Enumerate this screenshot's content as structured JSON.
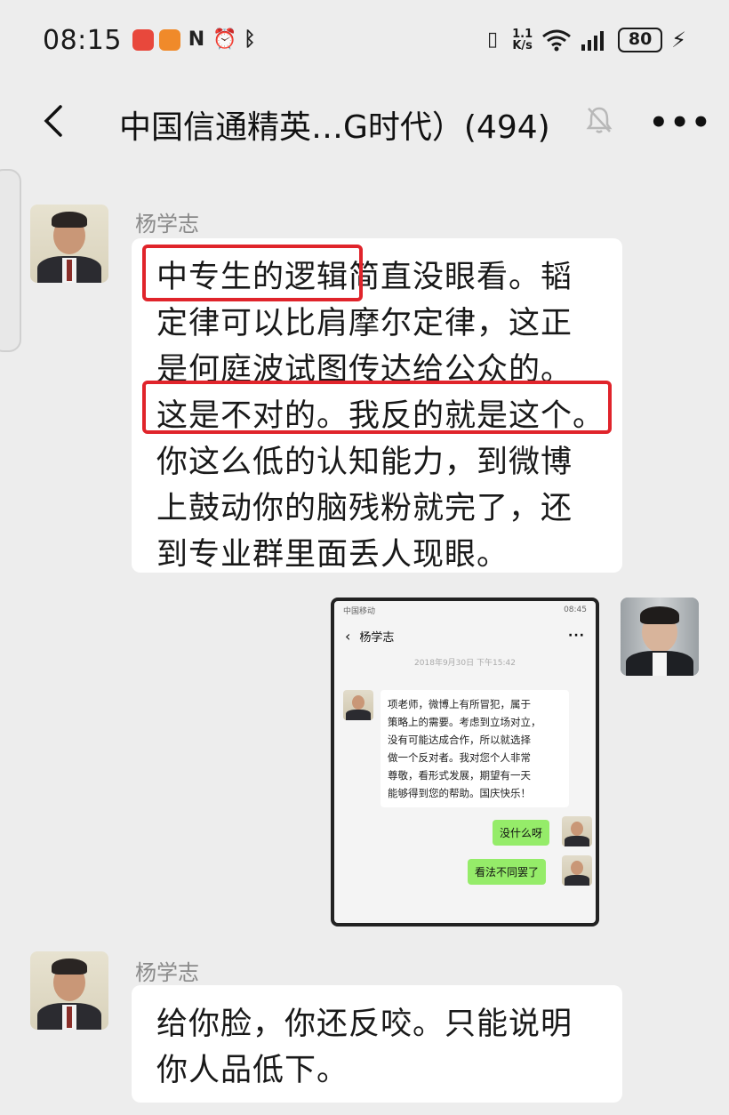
{
  "status_bar": {
    "time": "08:15",
    "net_speed_top": "1.1",
    "net_speed_bottom": "K/s",
    "battery": "80"
  },
  "nav": {
    "title": "中国信通精英…G时代）(494)"
  },
  "messages": [
    {
      "sender": "杨学志",
      "lines": [
        "中专生的逻辑简直没眼看。韬",
        "定律可以比肩摩尔定律，这正",
        "是何庭波试图传达给公众的。",
        "这是不对的。我反的就是这个。",
        "你这么低的认知能力，到微博",
        "上鼓动你的脑残粉就完了，还",
        "到专业群里面丢人现眼。"
      ]
    },
    {
      "sender": "杨学志",
      "lines": [
        "给你脸，你还反咬。只能说明",
        "你人品低下。"
      ]
    }
  ],
  "screenshot_image": {
    "status_left": "中国移动",
    "status_right": "08:45",
    "contact": "杨学志",
    "date": "2018年9月30日 下午15:42",
    "incoming_lines": [
      "项老师，微博上有所冒犯，属于",
      "策略上的需要。考虑到立场对立，",
      "没有可能达成合作，所以就选择",
      "做一个反对者。我对您个人非常",
      "尊敬，看形式发展，期望有一天",
      "能够得到您的帮助。国庆快乐！"
    ],
    "reply_1": "没什么呀",
    "reply_2": "看法不同罢了"
  },
  "colors": {
    "background": "#ededed",
    "bubble": "#ffffff",
    "highlight": "#e0242b",
    "outgoing_bubble": "#95ec69"
  }
}
